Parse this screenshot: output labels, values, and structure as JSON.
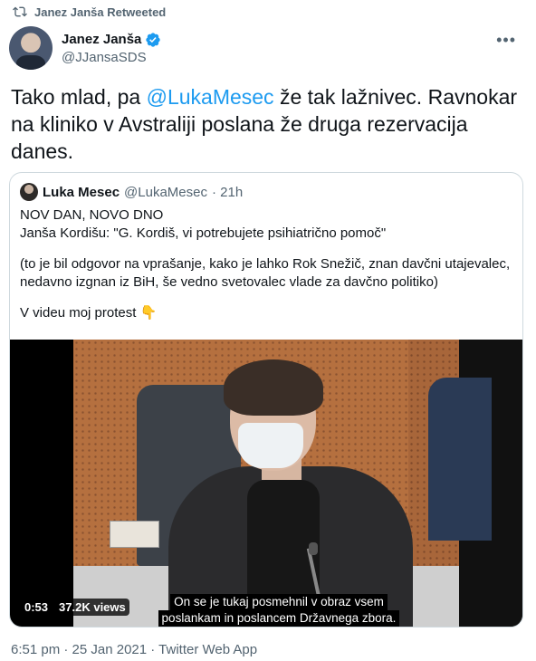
{
  "retweet": {
    "label": "Janez Janša Retweeted"
  },
  "author": {
    "name": "Janez Janša",
    "handle": "@JJansaSDS",
    "verified": true
  },
  "tweet": {
    "pre": "Tako mlad, pa ",
    "mention": "@LukaMesec",
    "post": " že tak lažnivec. Ravnokar na kliniko v Avstraliji poslana že druga rezervacija danes."
  },
  "quote": {
    "name": "Luka Mesec",
    "handle": "@LukaMesec",
    "time": "· 21h",
    "line1": "NOV DAN, NOVO DNO",
    "line2": "Janša Kordišu: \"G. Kordiš, vi potrebujete psihiatrično pomoč\"",
    "line3": "(to je bil odgovor na vprašanje, kako je lahko Rok Snežič, znan davčni utajevalec, nedavno izgnan iz BiH, še vedno svetovalec vlade za davčno politiko)",
    "line4": "V videu moj protest 👇"
  },
  "video": {
    "duration": "0:53",
    "views": "37.2K views",
    "subtitle_1": "On se je tukaj posmehnil v obraz vsem",
    "subtitle_2": "poslankam in poslancem Državnega zbora."
  },
  "footer": {
    "meta": "6:51 pm · 25 Jan 2021 · Twitter Web App"
  },
  "colors": {
    "accent": "#1d9bf0",
    "secondary_text": "#536471",
    "border": "#cfd9de"
  }
}
